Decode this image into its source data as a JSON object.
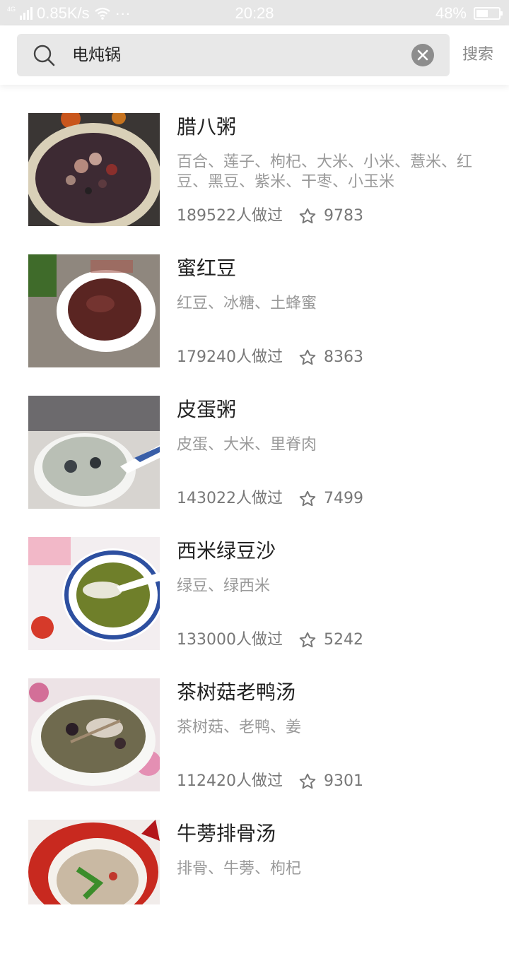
{
  "status_bar": {
    "network": "4G",
    "speed": "0.85K/s",
    "more": "···",
    "time": "20:28",
    "battery": "48%",
    "battery_level": 0.48
  },
  "search": {
    "query": "电炖锅",
    "submit_label": "搜索"
  },
  "recipes": [
    {
      "title": "腊八粥",
      "ingredients": "百合、莲子、枸杞、大米、小米、薏米、红豆、黑豆、紫米、干枣、小玉米",
      "cooked": "189522人做过",
      "favorites": "9783"
    },
    {
      "title": "蜜红豆",
      "ingredients": "红豆、冰糖、土蜂蜜",
      "cooked": "179240人做过",
      "favorites": "8363"
    },
    {
      "title": "皮蛋粥",
      "ingredients": "皮蛋、大米、里脊肉",
      "cooked": "143022人做过",
      "favorites": "7499"
    },
    {
      "title": "西米绿豆沙",
      "ingredients": "绿豆、绿西米",
      "cooked": "133000人做过",
      "favorites": "5242"
    },
    {
      "title": "茶树菇老鸭汤",
      "ingredients": "茶树菇、老鸭、姜",
      "cooked": "112420人做过",
      "favorites": "9301"
    },
    {
      "title": "牛蒡排骨汤",
      "ingredients": "排骨、牛蒡、枸杞",
      "cooked": "",
      "favorites": ""
    }
  ]
}
